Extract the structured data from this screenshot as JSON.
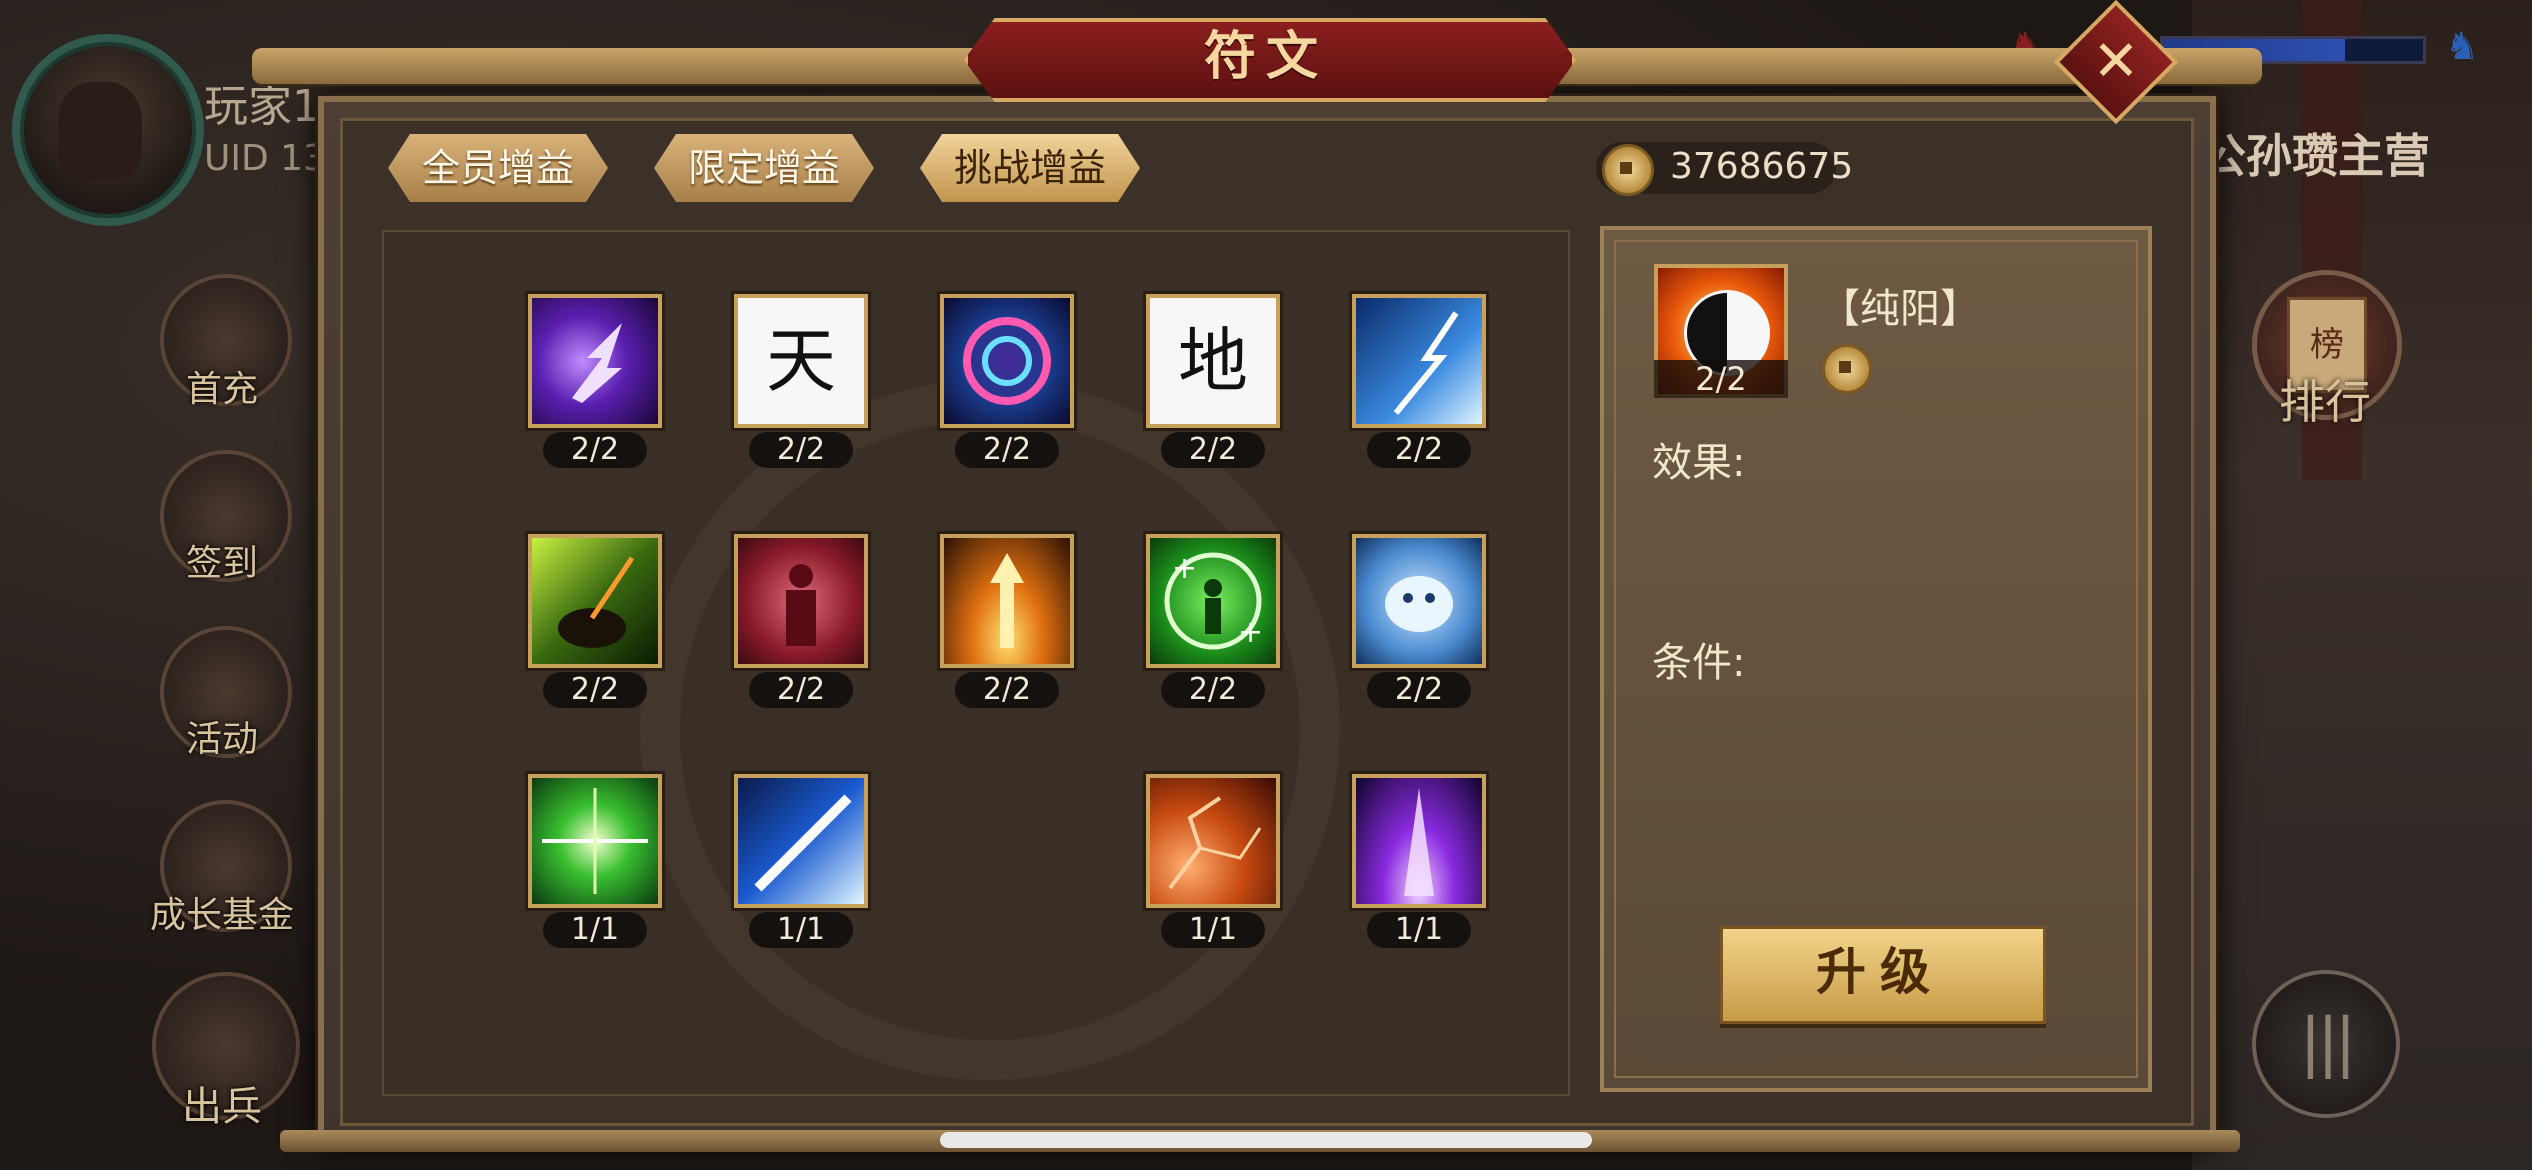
{
  "player": {
    "name": "玩家1",
    "uid": "UID 13"
  },
  "sidebar": {
    "items": [
      {
        "label": "首充",
        "icon": "gift-pot-icon"
      },
      {
        "label": "签到",
        "icon": "scroll-book-icon"
      },
      {
        "label": "活动",
        "icon": "flower-basket-icon"
      },
      {
        "label": "成长基金",
        "icon": "plant-icon"
      },
      {
        "label": "出兵",
        "icon": "army-flag-icon"
      }
    ]
  },
  "right_side": {
    "camp": "公孙瓒主营",
    "rank_label": "排行",
    "rank_badge": "榜"
  },
  "dialog": {
    "title": "符文",
    "close": "✕",
    "tabs": [
      {
        "label": "全员增益",
        "active": false
      },
      {
        "label": "限定增益",
        "active": false
      },
      {
        "label": "挑战增益",
        "active": true
      }
    ],
    "currency": "37686675"
  },
  "runes": [
    {
      "name": "lightning-arrow",
      "count": "2/2"
    },
    {
      "name": "heaven",
      "count": "2/2",
      "glyph": "天"
    },
    {
      "name": "vortex",
      "count": "2/2"
    },
    {
      "name": "earth",
      "count": "2/2",
      "glyph": "地"
    },
    {
      "name": "ice-bolt",
      "count": "2/2"
    },
    {
      "name": "dark-rider",
      "count": "2/2"
    },
    {
      "name": "blood-warrior",
      "count": "2/2"
    },
    {
      "name": "flame-rise",
      "count": "2/2"
    },
    {
      "name": "heal-aura",
      "count": "2/2"
    },
    {
      "name": "ice-tiger",
      "count": "2/2"
    },
    {
      "name": "green-burst",
      "count": "1/1"
    },
    {
      "name": "blue-beam",
      "count": "1/1"
    },
    {
      "name": "fire-crack",
      "count": "1/1"
    },
    {
      "name": "purple-pillar",
      "count": "1/1"
    }
  ],
  "detail": {
    "name": "【纯阳】",
    "count": "2/2",
    "effect_label": "效果:",
    "condition_label": "条件:",
    "upgrade_label": "升级"
  }
}
